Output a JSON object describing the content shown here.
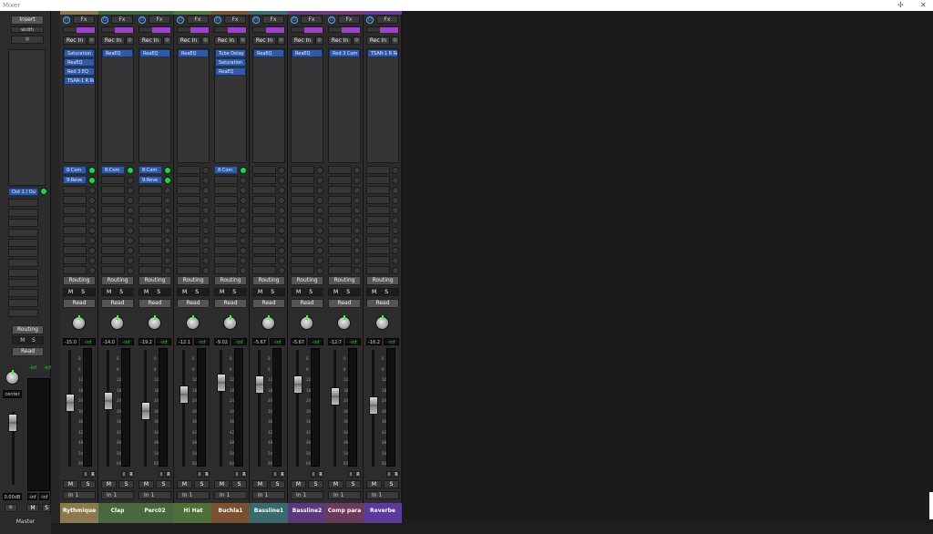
{
  "window": {
    "title": "Mixer",
    "pin_icon": "pin-icon",
    "close_icon": "close-icon"
  },
  "master": {
    "insert_label": "Insert",
    "width_label": "width",
    "output_label": "Out 1 / Ou",
    "routing_label": "Routing",
    "mute_label": "M",
    "solo_label": "S",
    "automation_label": "Read",
    "pan_label": "center",
    "peak_left": "-inf",
    "peak_right": "-inf",
    "volume_readout": "0.00dB",
    "meter_left": "-inf",
    "meter_right": "-inf",
    "name": "Master"
  },
  "common": {
    "fx_label": "Fx",
    "rec_in_label": "Rec In",
    "routing_label": "Routing",
    "mute_label": "M",
    "solo_label": "S",
    "automation_label": "Read",
    "input_label": "I",
    "record_label": "R",
    "meter_value": "-inf",
    "scale": [
      "0",
      "6",
      "12",
      "18",
      "24",
      "30",
      "36",
      "42",
      "48",
      "54",
      "60"
    ]
  },
  "tracks": [
    {
      "name": "Rythmique",
      "color": "#8a7a4e",
      "name_bg": "#8a7a4e",
      "fx": [
        "Saturation",
        "ReaEQ",
        "Red 3 EQ",
        "TSAR-1 R Re"
      ],
      "sends": [
        "8:Com",
        "9:Reve"
      ],
      "volume": "-15.0",
      "in": "In 1",
      "fader": 0.55
    },
    {
      "name": "Clap",
      "color": "#3f6a3f",
      "name_bg": "#48693d",
      "fx": [
        "ReaEQ"
      ],
      "sends": [
        "8:Com"
      ],
      "volume": "-14.0",
      "in": "In 1",
      "fader": 0.56
    },
    {
      "name": "Perc02",
      "color": "#3f6a3f",
      "name_bg": "#48693d",
      "fx": [
        "ReaEQ"
      ],
      "sends": [
        "8:Com",
        "9:Reve"
      ],
      "volume": "-19.2",
      "in": "In 1",
      "fader": 0.48
    },
    {
      "name": "Hi Hat",
      "color": "#4f7a3a",
      "name_bg": "#50703a",
      "fx": [
        "ReaEQ"
      ],
      "sends": [],
      "volume": "-12.1",
      "in": "In 1",
      "fader": 0.62
    },
    {
      "name": "Buchla1",
      "color": "#7a5530",
      "name_bg": "#7a5030",
      "fx": [
        "Tube Delay",
        "Saturation",
        "ReaEQ"
      ],
      "sends": [
        "8:Com"
      ],
      "volume": "-9.02",
      "in": "In 1",
      "fader": 0.72
    },
    {
      "name": "Bassline1",
      "color": "#3d6e70",
      "name_bg": "#3a6a6a",
      "fx": [
        "ReaEQ"
      ],
      "sends": [],
      "volume": "-5.67",
      "in": "In 1",
      "fader": 0.7
    },
    {
      "name": "Bassline2",
      "color": "#6a3a8a",
      "name_bg": "#5a3a7a",
      "fx": [
        "ReaEQ"
      ],
      "sends": [],
      "volume": "-5.67",
      "in": "In 1",
      "fader": 0.7
    },
    {
      "name": "Comp para",
      "color": "#7a3a7a",
      "name_bg": "#6a3a5a",
      "fx": [
        "Red 3 Com"
      ],
      "sends": [],
      "volume": "-12.7",
      "in": "In 1",
      "fader": 0.6
    },
    {
      "name": "Reverbe",
      "color": "#6a3aa0",
      "name_bg": "#5a3a9a",
      "fx": [
        "TSAR-1 R Re"
      ],
      "sends": [],
      "volume": "-16.2",
      "in": "In 1",
      "fader": 0.52
    }
  ]
}
